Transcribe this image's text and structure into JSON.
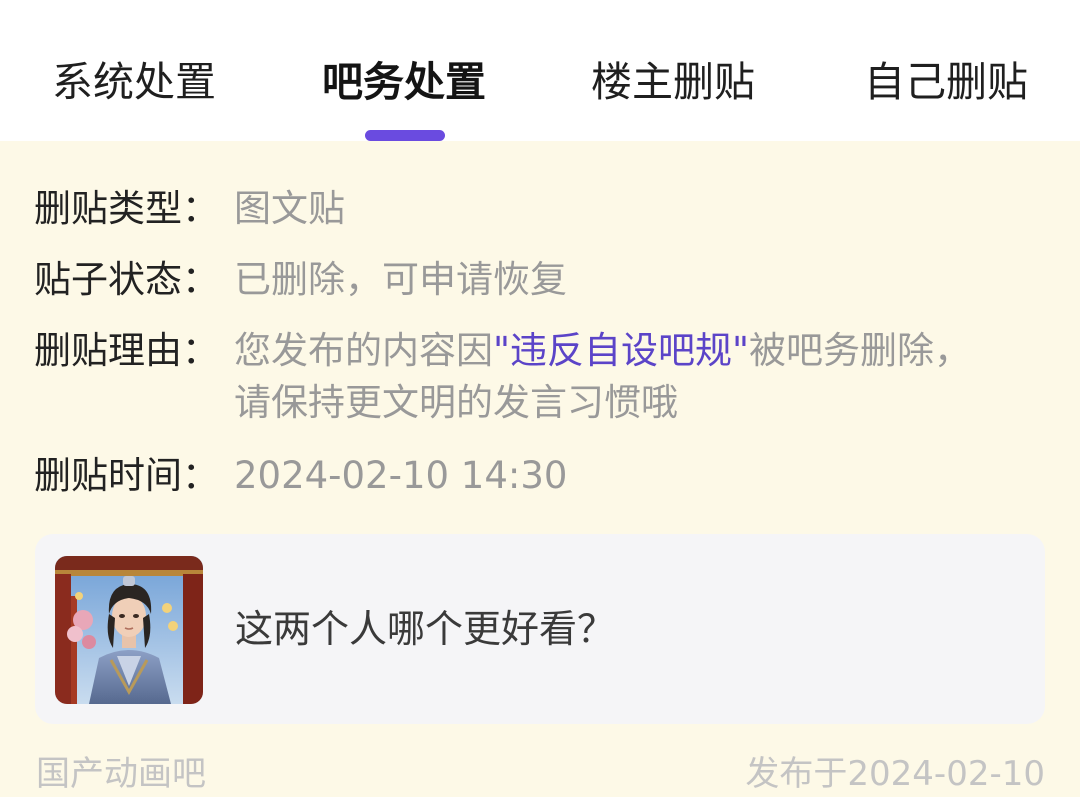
{
  "tabs": {
    "system": "系统处置",
    "admin": "吧务处置",
    "owner": "楼主删贴",
    "self": "自己删贴",
    "active": "admin"
  },
  "details": {
    "type_label": "删贴类型：",
    "type_value": "图文贴",
    "status_label": "贴子状态：",
    "status_value": "已删除，可申请恢复",
    "reason_label": "删贴理由：",
    "reason_prefix": "您发布的内容因",
    "reason_highlight": "\"违反自设吧规\"",
    "reason_suffix": "被吧务删除，",
    "reason_line2": "请保持更文明的发言习惯哦",
    "time_label": "删贴时间：",
    "time_value": "2024-02-10 14:30"
  },
  "post": {
    "title": "这两个人哪个更好看？",
    "thumbnail_icon": "post-thumbnail-image"
  },
  "footer": {
    "forum": "国产动画吧",
    "published": "发布于2024-02-10"
  },
  "colors": {
    "accent": "#6a4be0",
    "highlight": "#5b44c8",
    "panel_bg": "#fdf9e7",
    "card_bg": "#f5f5f7",
    "muted": "#999999"
  }
}
